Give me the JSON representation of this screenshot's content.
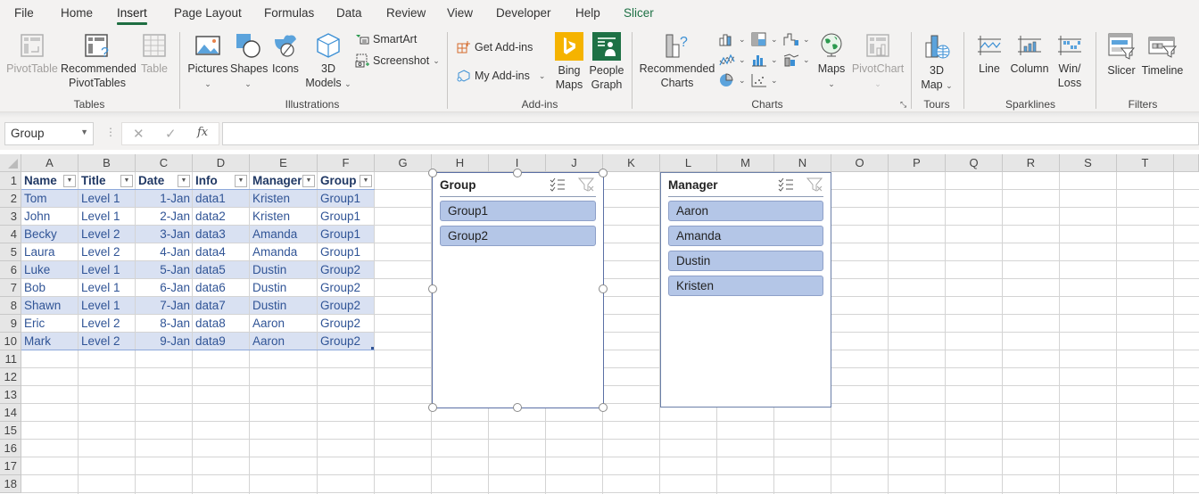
{
  "tabs": [
    {
      "label": "File"
    },
    {
      "label": "Home"
    },
    {
      "label": "Insert",
      "active": true
    },
    {
      "label": "Page Layout"
    },
    {
      "label": "Formulas"
    },
    {
      "label": "Data"
    },
    {
      "label": "Review"
    },
    {
      "label": "View"
    },
    {
      "label": "Developer"
    },
    {
      "label": "Help"
    },
    {
      "label": "Slicer",
      "contextual": true
    }
  ],
  "ribbon": {
    "groups": {
      "tables": "Tables",
      "illustrations": "Illustrations",
      "addins": "Add-ins",
      "charts": "Charts",
      "tours": "Tours",
      "sparklines": "Sparklines",
      "filters": "Filters"
    },
    "buttons": {
      "pivottable": "PivotTable",
      "recommended_pivottables_1": "Recommended",
      "recommended_pivottables_2": "PivotTables",
      "table": "Table",
      "pictures": "Pictures",
      "shapes": "Shapes",
      "icons": "Icons",
      "models_1": "3D",
      "models_2": "Models",
      "smartart": "SmartArt",
      "screenshot": "Screenshot",
      "get_addins": "Get Add-ins",
      "my_addins": "My Add-ins",
      "bing_1": "Bing",
      "bing_2": "Maps",
      "people_1": "People",
      "people_2": "Graph",
      "reccharts_1": "Recommended",
      "reccharts_2": "Charts",
      "maps": "Maps",
      "pivotchart": "PivotChart",
      "map3d_1": "3D",
      "map3d_2": "Map",
      "line": "Line",
      "column": "Column",
      "winloss_1": "Win/",
      "winloss_2": "Loss",
      "slicer": "Slicer",
      "timeline": "Timeline"
    }
  },
  "formula_bar": {
    "name_box": "Group",
    "cancel": "✕",
    "enter": "✓",
    "fx": "fx",
    "formula": ""
  },
  "columns": [
    "A",
    "B",
    "C",
    "D",
    "E",
    "F",
    "G",
    "H",
    "I",
    "J",
    "K",
    "L",
    "M",
    "N",
    "O",
    "P",
    "Q",
    "R",
    "S",
    "T"
  ],
  "rows": [
    "1",
    "2",
    "3",
    "4",
    "5",
    "6",
    "7",
    "8",
    "9",
    "10",
    "11",
    "12",
    "13",
    "14",
    "15",
    "16",
    "17",
    "18"
  ],
  "table": {
    "headers": [
      "Name",
      "Title",
      "Date",
      "Info",
      "Manager",
      "Group"
    ],
    "rows": [
      [
        "Tom",
        "Level 1",
        "1-Jan",
        "data1",
        "Kristen",
        "Group1"
      ],
      [
        "John",
        "Level 1",
        "2-Jan",
        "data2",
        "Kristen",
        "Group1"
      ],
      [
        "Becky",
        "Level 2",
        "3-Jan",
        "data3",
        "Amanda",
        "Group1"
      ],
      [
        "Laura",
        "Level 2",
        "4-Jan",
        "data4",
        "Amanda",
        "Group1"
      ],
      [
        "Luke",
        "Level 1",
        "5-Jan",
        "data5",
        "Dustin",
        "Group2"
      ],
      [
        "Bob",
        "Level 1",
        "6-Jan",
        "data6",
        "Dustin",
        "Group2"
      ],
      [
        "Shawn",
        "Level 1",
        "7-Jan",
        "data7",
        "Dustin",
        "Group2"
      ],
      [
        "Eric",
        "Level 2",
        "8-Jan",
        "data8",
        "Aaron",
        "Group2"
      ],
      [
        "Mark",
        "Level 2",
        "9-Jan",
        "data9",
        "Aaron",
        "Group2"
      ]
    ]
  },
  "slicers": {
    "group": {
      "title": "Group",
      "items": [
        "Group1",
        "Group2"
      ],
      "selected": true
    },
    "manager": {
      "title": "Manager",
      "items": [
        "Aaron",
        "Amanda",
        "Dustin",
        "Kristen"
      ],
      "selected": false
    }
  },
  "colors": {
    "accent_green": "#1e6e42",
    "table_band": "#d9e1f2",
    "table_text": "#305496",
    "slicer_item": "#b4c6e7"
  }
}
